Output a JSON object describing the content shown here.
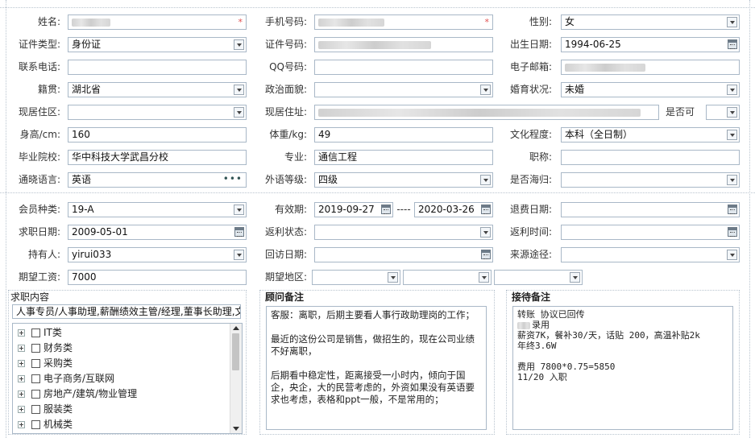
{
  "form": {
    "name": {
      "label": "姓名:",
      "value": ""
    },
    "phone": {
      "label": "手机号码:",
      "value": ""
    },
    "gender": {
      "label": "性别:",
      "value": "女"
    },
    "id_type": {
      "label": "证件类型:",
      "value": "身份证"
    },
    "id_number": {
      "label": "证件号码:",
      "value": ""
    },
    "birth_date": {
      "label": "出生日期:",
      "value": "1994-06-25"
    },
    "contact_phone": {
      "label": "联系电话:",
      "value": ""
    },
    "qq": {
      "label": "QQ号码:",
      "value": ""
    },
    "email": {
      "label": "电子邮箱:",
      "value": ""
    },
    "native_place": {
      "label": "籍贯:",
      "value": "湖北省"
    },
    "political_status": {
      "label": "政治面貌:",
      "value": ""
    },
    "marital_status": {
      "label": "婚育状况:",
      "value": "未婚"
    },
    "residence_area": {
      "label": "现居住区:",
      "value": ""
    },
    "residence_address": {
      "label": "现居住址:",
      "value": ""
    },
    "is_ok": {
      "label": "是否可",
      "value": ""
    },
    "height": {
      "label": "身高/cm:",
      "value": "160"
    },
    "weight": {
      "label": "体重/kg:",
      "value": "49"
    },
    "education": {
      "label": "文化程度:",
      "value": "本科（全日制）"
    },
    "school": {
      "label": "毕业院校:",
      "value": "华中科技大学武昌分校"
    },
    "major": {
      "label": "专业:",
      "value": "通信工程"
    },
    "title": {
      "label": "职称:",
      "value": ""
    },
    "language": {
      "label": "通晓语言:",
      "value": "英语"
    },
    "language_level": {
      "label": "外语等级:",
      "value": "四级"
    },
    "returnee": {
      "label": "是否海归:",
      "value": ""
    }
  },
  "membership": {
    "member_type": {
      "label": "会员种类:",
      "value": "19-A"
    },
    "validity": {
      "label": "有效期:",
      "start": "2019-09-27",
      "sep": "----",
      "end": "2020-03-26"
    },
    "refund_date": {
      "label": "退费日期:",
      "value": ""
    },
    "job_date": {
      "label": "求职日期:",
      "value": "2009-05-01"
    },
    "rebate_status": {
      "label": "返利状态:",
      "value": ""
    },
    "rebate_time": {
      "label": "返利时间:",
      "value": ""
    },
    "holder": {
      "label": "持有人:",
      "value": "yirui033"
    },
    "visit_date": {
      "label": "回访日期:",
      "value": ""
    },
    "source": {
      "label": "来源途径:",
      "value": ""
    },
    "salary": {
      "label": "期望工资:",
      "value": "7000"
    },
    "region": {
      "label": "期望地区:",
      "value1": "",
      "value2": "",
      "value3": ""
    }
  },
  "job_panel": {
    "title": "求职内容",
    "selected": "人事专员/人事助理,薪酬绩效主管/经理,董事长助理,文",
    "tree": [
      "IT类",
      "财务类",
      "采购类",
      "电子商务/互联网",
      "房地产/建筑/物业管理",
      "服装类",
      "机械类"
    ]
  },
  "advisor_panel": {
    "title": "顾问备注",
    "text": "客服：离职，后期主要看人事行政助理岗的工作；\n\n最近的这份公司是销售，做招生的，现在公司业绩不好离职，\n\n后期看中稳定性，距离接受一小时内，倾向于国企，央企，大的民营考虑的，外资如果没有英语要求也考虑，表格和ppt一般，不是常用的；"
  },
  "reception_panel": {
    "title": "接待备注",
    "line1": "转账 协议已回传",
    "line2": "录用",
    "line3": "薪资7K，餐补30/天，话贴 200，高温补贴2k",
    "line4": "年终3.6W",
    "line5": "",
    "line6": "费用 7800*0.75=5850",
    "line7": "11/20 入职"
  }
}
